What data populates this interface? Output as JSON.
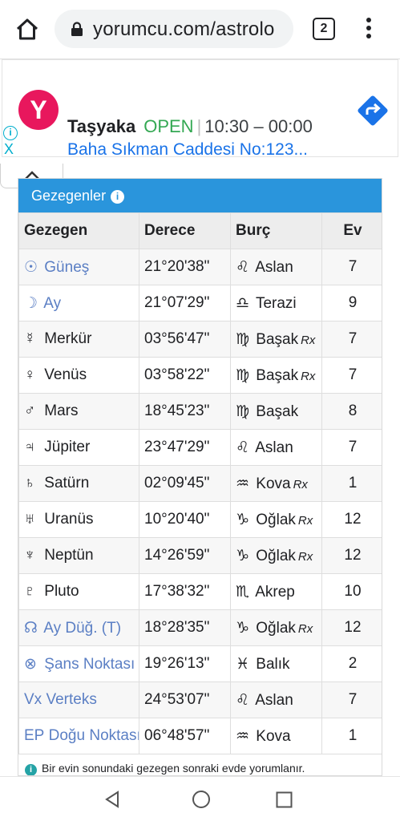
{
  "browser": {
    "url": "yorumcu.com/astrolo",
    "tab_count": "2"
  },
  "ad": {
    "logo_letter": "Y",
    "name": "Taşyaka",
    "status": "OPEN",
    "hours": "10:30 – 00:00",
    "address": "Baha Sıkman Caddesi No:123...",
    "info_glyph": "i",
    "close_glyph": "X",
    "colors": {
      "logo": "#e8175d",
      "open": "#34a853",
      "link": "#1a73e8",
      "directions": "#1a73e8"
    }
  },
  "panel": {
    "title": "Gezegenler",
    "header_color": "#2a95dc",
    "columns": [
      "Gezegen",
      "Derece",
      "Burç",
      "Ev"
    ],
    "rows": [
      {
        "sym": "☉",
        "planet": "Güneş",
        "degree": "21°20'38\"",
        "sign_sym": "♌",
        "sign": "Aslan",
        "rx": "",
        "house": "7",
        "link": true
      },
      {
        "sym": "☽",
        "planet": "Ay",
        "degree": "21°07'29\"",
        "sign_sym": "♎",
        "sign": "Terazi",
        "rx": "",
        "house": "9",
        "link": true
      },
      {
        "sym": "☿",
        "planet": "Merkür",
        "degree": "03°56'47\"",
        "sign_sym": "♍",
        "sign": "Başak",
        "rx": "Rx",
        "house": "7",
        "link": false
      },
      {
        "sym": "♀",
        "planet": "Venüs",
        "degree": "03°58'22\"",
        "sign_sym": "♍",
        "sign": "Başak",
        "rx": "Rx",
        "house": "7",
        "link": false
      },
      {
        "sym": "♂",
        "planet": "Mars",
        "degree": "18°45'23\"",
        "sign_sym": "♍",
        "sign": "Başak",
        "rx": "",
        "house": "8",
        "link": false
      },
      {
        "sym": "♃",
        "planet": "Jüpiter",
        "degree": "23°47'29\"",
        "sign_sym": "♌",
        "sign": "Aslan",
        "rx": "",
        "house": "7",
        "link": false
      },
      {
        "sym": "♄",
        "planet": "Satürn",
        "degree": "02°09'45\"",
        "sign_sym": "♒",
        "sign": "Kova",
        "rx": "Rx",
        "house": "1",
        "link": false
      },
      {
        "sym": "♅",
        "planet": "Uranüs",
        "degree": "10°20'40\"",
        "sign_sym": "♑",
        "sign": "Oğlak",
        "rx": "Rx",
        "house": "12",
        "link": false
      },
      {
        "sym": "♆",
        "planet": "Neptün",
        "degree": "14°26'59\"",
        "sign_sym": "♑",
        "sign": "Oğlak",
        "rx": "Rx",
        "house": "12",
        "link": false
      },
      {
        "sym": "♇",
        "planet": "Pluto",
        "degree": "17°38'32\"",
        "sign_sym": "♏",
        "sign": "Akrep",
        "rx": "",
        "house": "10",
        "link": false
      },
      {
        "sym": "☊",
        "planet": "Ay Düğ. (T)",
        "degree": "18°28'35\"",
        "sign_sym": "♑",
        "sign": "Oğlak",
        "rx": "Rx",
        "house": "12",
        "link": true
      },
      {
        "sym": "⊗",
        "planet": "Şans Noktası",
        "degree": "19°26'13\"",
        "sign_sym": "♓",
        "sign": "Balık",
        "rx": "",
        "house": "2",
        "link": true
      },
      {
        "sym": "Vx",
        "planet": "Verteks",
        "degree": "24°53'07\"",
        "sign_sym": "♌",
        "sign": "Aslan",
        "rx": "",
        "house": "7",
        "link": true
      },
      {
        "sym": "EP",
        "planet": "Doğu Noktası",
        "degree": "06°48'57\"",
        "sign_sym": "♒",
        "sign": "Kova",
        "rx": "",
        "house": "1",
        "link": true
      }
    ],
    "footnote": "Bir evin sonundaki gezegen sonraki evde yorumlanır."
  }
}
